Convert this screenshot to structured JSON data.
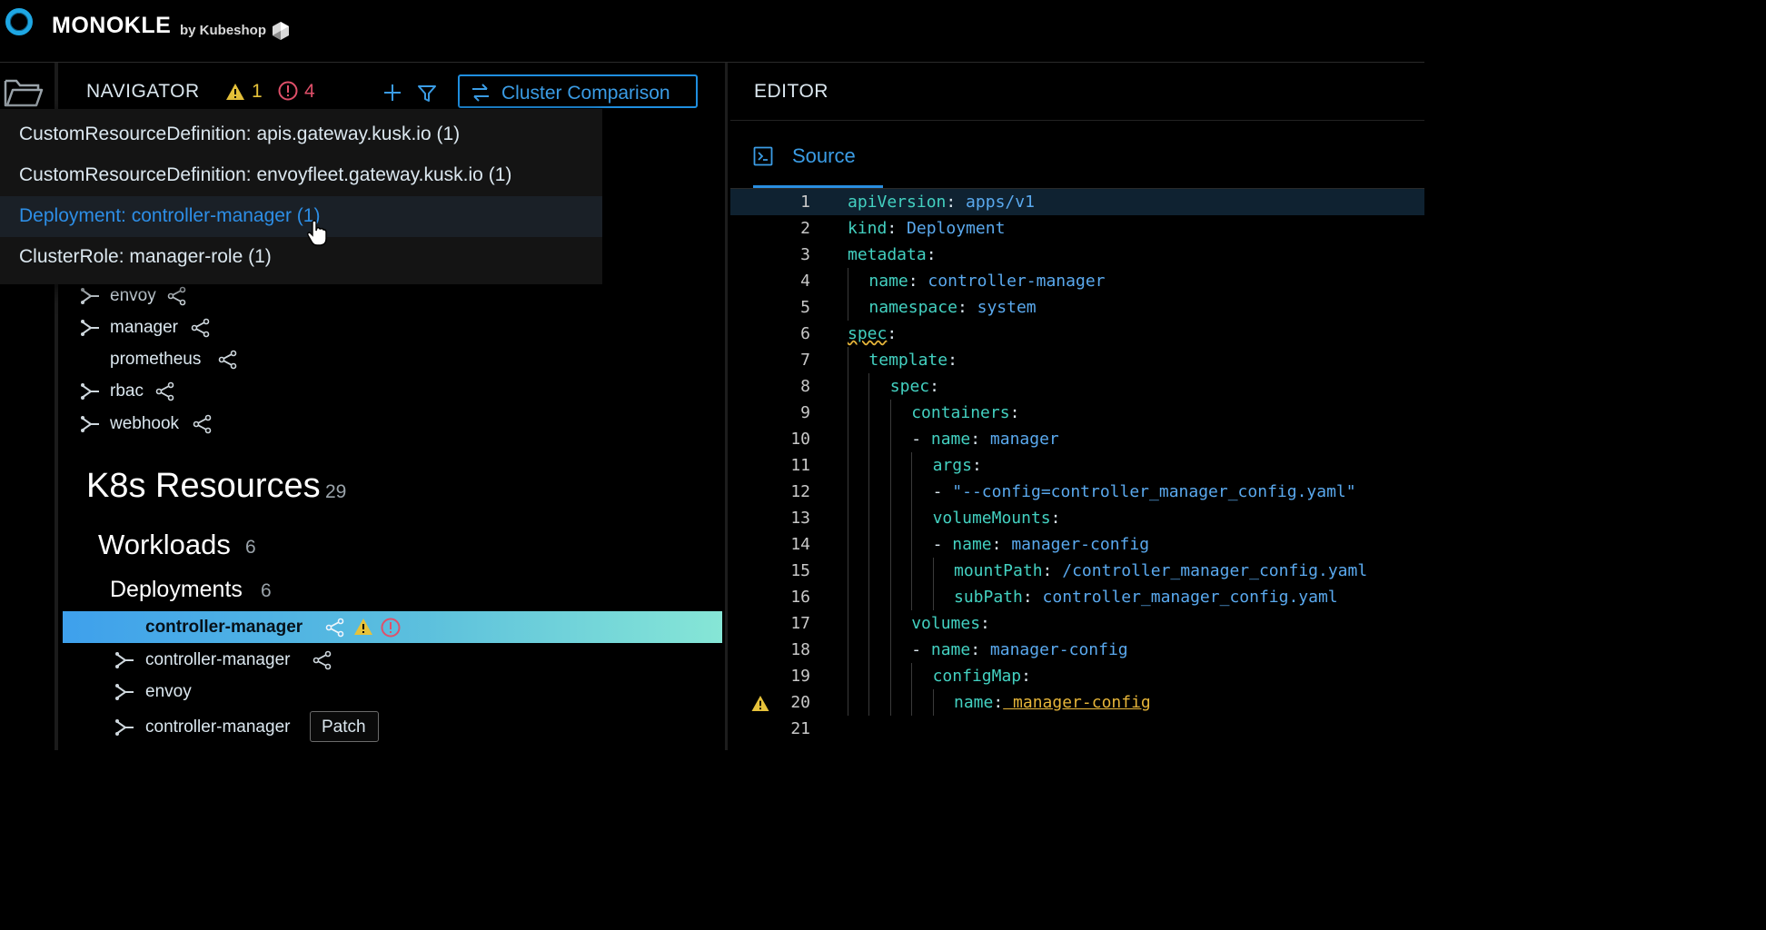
{
  "app": {
    "brand": "MONOKLE",
    "byline": "by Kubeshop"
  },
  "navigator": {
    "title": "NAVIGATOR",
    "warning_count": "1",
    "error_count": "4",
    "cluster_comparison_label": "Cluster Comparison",
    "dropdown": [
      {
        "label": "CustomResourceDefinition:  apis.gateway.kusk.io  (1)"
      },
      {
        "label": "CustomResourceDefinition:  envoyfleet.gateway.kusk.io  (1)"
      },
      {
        "label": "Deployment:  controller-manager  (1)"
      },
      {
        "label": "ClusterRole:  manager-role  (1)"
      }
    ],
    "kustomizations": [
      "envoy",
      "manager",
      "prometheus",
      "rbac",
      "webhook"
    ],
    "sections": {
      "k8s": {
        "title": "K8s Resources",
        "count": "29"
      },
      "workloads": {
        "title": "Workloads",
        "count": "6"
      },
      "deployments": {
        "title": "Deployments",
        "count": "6"
      }
    },
    "resources": [
      "controller-manager",
      "controller-manager",
      "envoy",
      "controller-manager"
    ],
    "patch_label": "Patch"
  },
  "editor": {
    "title": "EDITOR",
    "tab_label": "Source"
  },
  "code_lines": [
    {
      "n": "1",
      "indent": 0,
      "k": "apiVersion",
      "v": "apps/v1"
    },
    {
      "n": "2",
      "indent": 0,
      "k": "kind",
      "v": "Deployment"
    },
    {
      "n": "3",
      "indent": 0,
      "k": "metadata",
      "v": ""
    },
    {
      "n": "4",
      "indent": 1,
      "k": "name",
      "v": "controller-manager"
    },
    {
      "n": "5",
      "indent": 1,
      "k": "namespace",
      "v": "system"
    },
    {
      "n": "6",
      "indent": 0,
      "k": "spec",
      "v": ""
    },
    {
      "n": "7",
      "indent": 1,
      "k": "template",
      "v": ""
    },
    {
      "n": "8",
      "indent": 2,
      "k": "spec",
      "v": ""
    },
    {
      "n": "9",
      "indent": 3,
      "k": "containers",
      "v": ""
    },
    {
      "n": "10",
      "indent": 3,
      "dash": true,
      "k": "name",
      "v": "manager"
    },
    {
      "n": "11",
      "indent": 4,
      "k": "args",
      "v": ""
    },
    {
      "n": "12",
      "indent": 4,
      "dash": true,
      "k": "",
      "v": "\"--config=controller_manager_config.yaml\""
    },
    {
      "n": "13",
      "indent": 4,
      "k": "volumeMounts",
      "v": ""
    },
    {
      "n": "14",
      "indent": 4,
      "dash": true,
      "k": "name",
      "v": "manager-config"
    },
    {
      "n": "15",
      "indent": 5,
      "k": "mountPath",
      "v": "/controller_manager_config.yaml"
    },
    {
      "n": "16",
      "indent": 5,
      "k": "subPath",
      "v": "controller_manager_config.yaml"
    },
    {
      "n": "17",
      "indent": 3,
      "k": "volumes",
      "v": ""
    },
    {
      "n": "18",
      "indent": 3,
      "dash": true,
      "k": "name",
      "v": "manager-config"
    },
    {
      "n": "19",
      "indent": 4,
      "k": "configMap",
      "v": ""
    },
    {
      "n": "20",
      "indent": 5,
      "k": "name",
      "v": "manager-config"
    },
    {
      "n": "21",
      "indent": 0,
      "k": "",
      "v": ""
    }
  ],
  "colors": {
    "accent": "#2d8ee6",
    "warning": "#e6c23a",
    "error": "#e0506a",
    "yaml_key": "#43d1c1",
    "yaml_value": "#5aa9ee"
  }
}
